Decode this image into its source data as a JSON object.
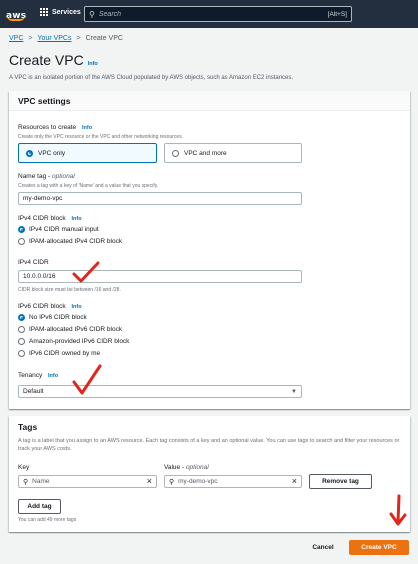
{
  "nav": {
    "logo_text": "aws",
    "services_label": "Services",
    "search_placeholder": "Search",
    "search_shortcut": "[Alt+S]"
  },
  "breadcrumb": {
    "items": [
      "VPC",
      "Your VPCs",
      "Create VPC"
    ],
    "separator": ">"
  },
  "page": {
    "title": "Create VPC",
    "info": "Info",
    "description": "A VPC is an isolated portion of the AWS Cloud populated by AWS objects, such as Amazon EC2 instances."
  },
  "vpc_settings": {
    "heading": "VPC settings",
    "resources": {
      "label": "Resources to create",
      "info": "Info",
      "hint": "Create only the VPC resource or the VPC and other networking resources.",
      "options": [
        "VPC only",
        "VPC and more"
      ],
      "selected": "VPC only"
    },
    "name_tag": {
      "label": "Name tag",
      "optional": "optional",
      "hint": "Creates a tag with a key of 'Name' and a value that you specify.",
      "value": "my-demo-vpc"
    },
    "ipv4_block": {
      "label": "IPv4 CIDR block",
      "info": "Info",
      "options": [
        "IPv4 CIDR manual input",
        "IPAM-allocated IPv4 CIDR block"
      ],
      "selected": "IPv4 CIDR manual input"
    },
    "ipv4_cidr": {
      "label": "IPv4 CIDR",
      "value": "10.0.0.0/16",
      "hint": "CIDR block size must be between /16 and /28."
    },
    "ipv6_block": {
      "label": "IPv6 CIDR block",
      "info": "Info",
      "options": [
        "No IPv6 CIDR block",
        "IPAM-allocated IPv6 CIDR block",
        "Amazon-provided IPv6 CIDR block",
        "IPv6 CIDR owned by me"
      ],
      "selected": "No IPv6 CIDR block"
    },
    "tenancy": {
      "label": "Tenancy",
      "info": "Info",
      "value": "Default"
    }
  },
  "tags": {
    "heading": "Tags",
    "description": "A tag is a label that you assign to an AWS resource. Each tag consists of a key and an optional value. You can use tags to search and filter your resources or track your AWS costs.",
    "key_label": "Key",
    "value_label": "Value",
    "value_optional": "optional",
    "key_value": "Name",
    "value_value": "my-demo-vpc",
    "remove_label": "Remove tag",
    "add_label": "Add tag",
    "limit_text": "You can add 49 more tags"
  },
  "footer": {
    "cancel_label": "Cancel",
    "create_label": "Create VPC"
  },
  "colors": {
    "nav_bg": "#232f3e",
    "link": "#0073bb",
    "primary": "#ec7211",
    "annotation": "#e0251b"
  }
}
